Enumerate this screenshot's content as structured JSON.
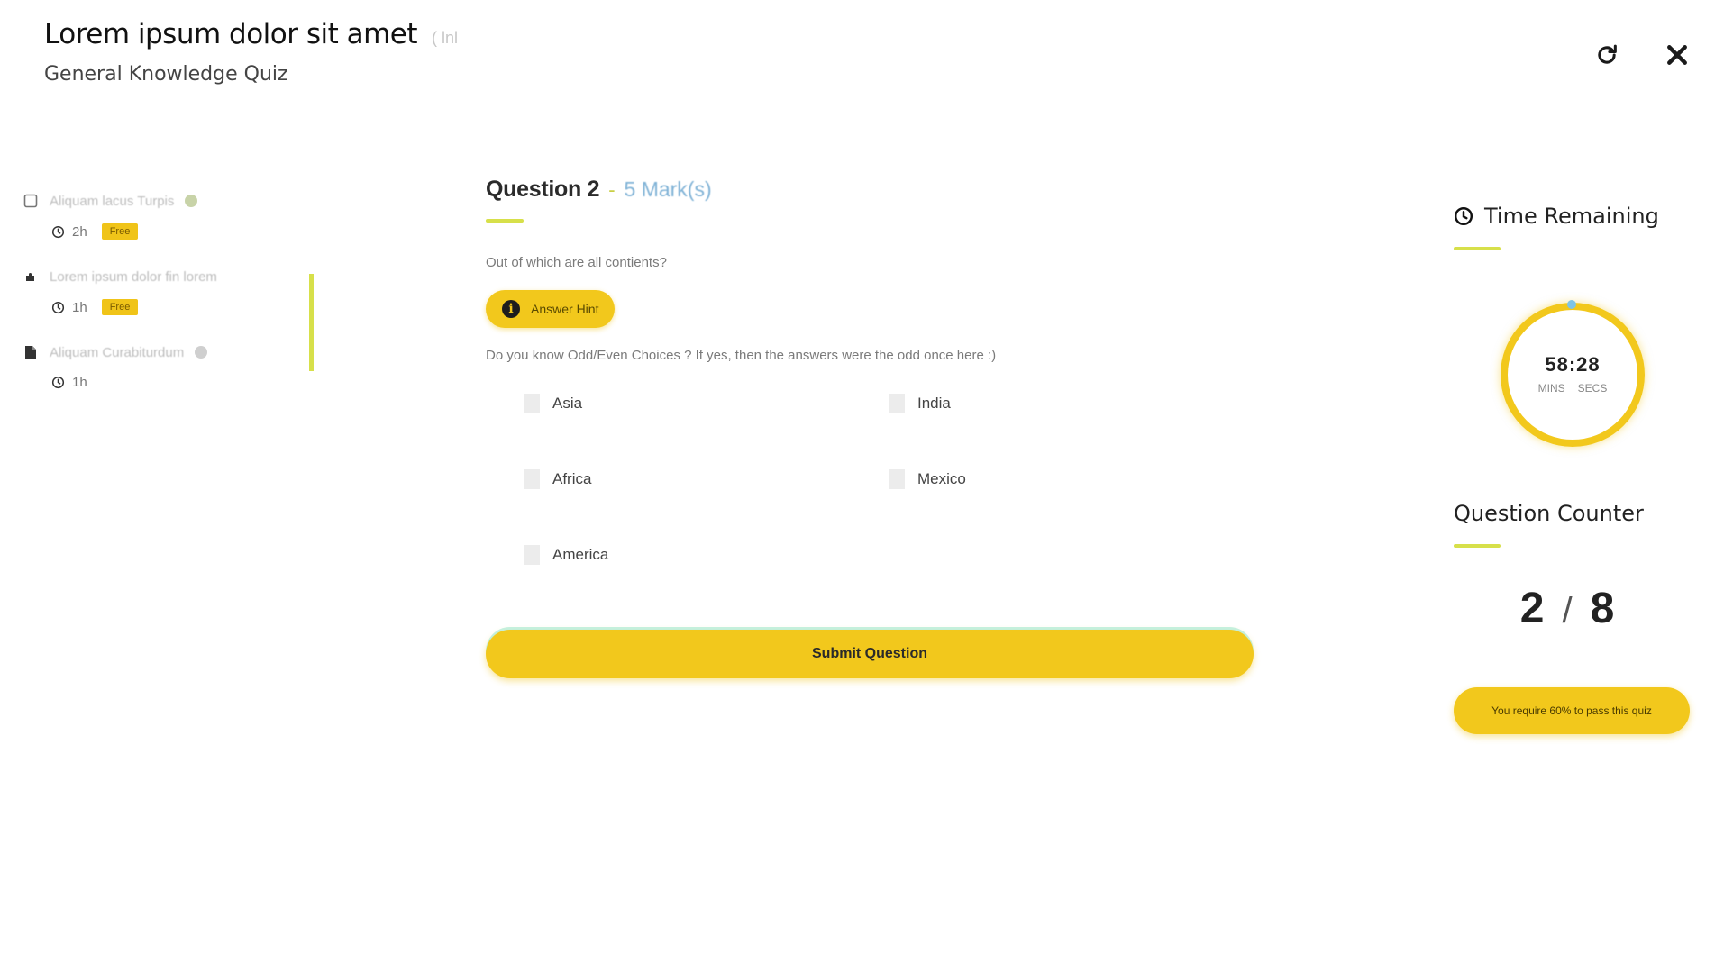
{
  "header": {
    "title": "Lorem ipsum dolor sit amet",
    "tag": "( lnl",
    "subtitle": "General Knowledge Quiz"
  },
  "actions": {
    "refresh_icon": "refresh-icon",
    "close_icon": "close-icon"
  },
  "sidebar": {
    "items": [
      {
        "label": "Aliquam lacus Turpis",
        "duration": "2h",
        "badge": "Free",
        "icon": "checkbox-icon",
        "completed": true
      },
      {
        "label": "Lorem ipsum dolor fin lorem",
        "duration": "1h",
        "badge": "Free",
        "icon": "puzzle-icon",
        "active": true
      },
      {
        "label": "Aliquam Curabiturdum",
        "duration": "1h",
        "badge": "",
        "icon": "document-icon",
        "completed": true
      }
    ]
  },
  "question": {
    "title": "Question 2",
    "separator": "-",
    "marks": "5 Mark(s)",
    "text": "Out of which are all contients?",
    "hint_label": "Answer Hint",
    "note": "Do you know Odd/Even Choices ? If yes, then the answers were the odd once here :)",
    "options": [
      "Asia",
      "India",
      "Africa",
      "Mexico",
      "America"
    ],
    "submit_label": "Submit Question"
  },
  "timer": {
    "title": "Time Remaining",
    "value": "58:28",
    "unit_mins": "MINS",
    "unit_secs": "SECS"
  },
  "counter": {
    "title": "Question Counter",
    "current": "2",
    "slash": "/",
    "total": "8"
  },
  "pass_note": "You require 60% to pass this quiz",
  "colors": {
    "accent": "#f2c81c",
    "underline": "#d7e04a",
    "marks": "#7fb2d6"
  }
}
